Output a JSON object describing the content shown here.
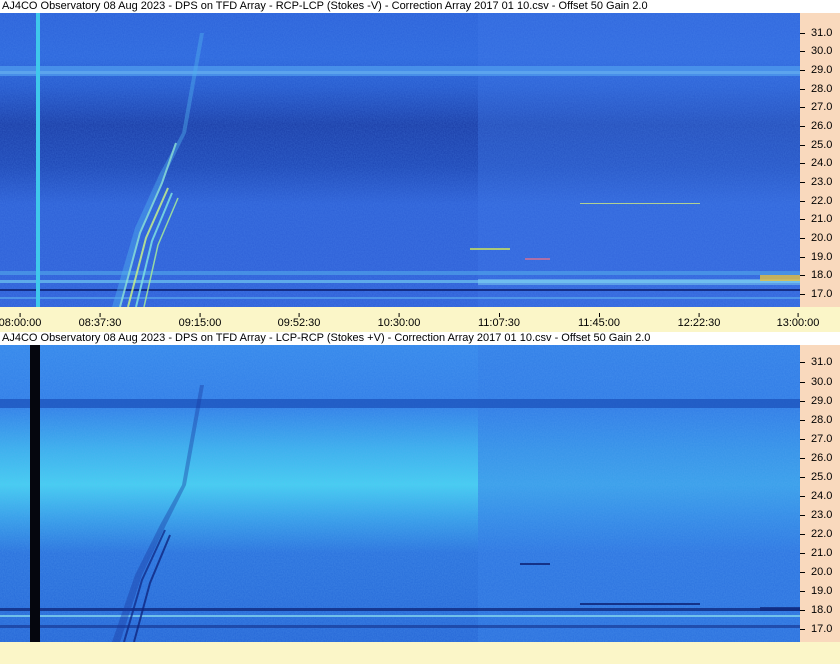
{
  "panels": [
    {
      "title": "AJ4CO Observatory 08 Aug 2023 -  DPS on TFD Array  -  RCP-LCP (Stokes -V)  -  Correction Array 2017 01 10.csv  -  Offset 50  Gain 2.0"
    },
    {
      "title": "AJ4CO Observatory 08 Aug 2023 -  DPS on TFD Array  -  LCP-RCP (Stokes +V)  -  Correction Array 2017 01 10.csv  -  Offset 50  Gain 2.0"
    }
  ],
  "frequency_labels": [
    "31.0",
    "30.0",
    "29.0",
    "28.0",
    "27.0",
    "26.0",
    "25.0",
    "24.0",
    "23.0",
    "22.0",
    "21.0",
    "20.0",
    "19.0",
    "18.0",
    "17.0"
  ],
  "time_labels": [
    "08:00:00",
    "08:37:30",
    "09:15:00",
    "09:52:30",
    "10:30:00",
    "11:07:30",
    "11:45:00",
    "12:22:30",
    "13:00:00"
  ],
  "colors": {
    "panel1_base": "#2a5fd6",
    "panel1_dark_band": "#1a3fa8",
    "panel2_base": "#2f7fe6",
    "panel2_bright_band": "#3fc4ee",
    "freq_axis_bg": "#f9d9bd",
    "time_axis_bg": "#fbf6c8"
  }
}
